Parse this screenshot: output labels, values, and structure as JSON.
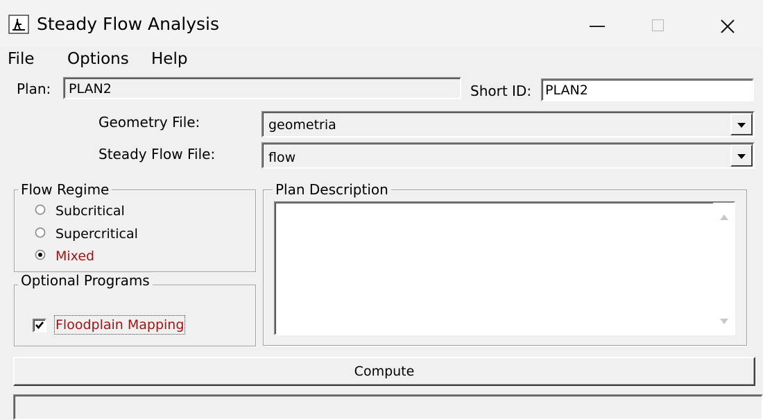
{
  "window": {
    "title": "Steady Flow Analysis",
    "icon": "hec-ras-app-icon"
  },
  "menu": [
    "File",
    "Options",
    "Help"
  ],
  "plan": {
    "label": "Plan:",
    "value": "PLAN2",
    "short_id_label": "Short ID:",
    "short_id_value": "PLAN2"
  },
  "geometry": {
    "label": "Geometry File:",
    "value": "geometria"
  },
  "steady_flow": {
    "label": "Steady Flow File:",
    "value": "flow"
  },
  "flow_regime": {
    "title": "Flow Regime",
    "options": [
      "Subcritical",
      "Supercritical",
      "Mixed"
    ],
    "selected": "Mixed"
  },
  "optional_programs": {
    "title": "Optional Programs",
    "floodplain_mapping_label": "Floodplain Mapping",
    "floodplain_mapping_checked": true
  },
  "plan_description": {
    "title": "Plan Description",
    "value": ""
  },
  "compute_label": "Compute",
  "status_text": "",
  "colors": {
    "accent_red": "#9e1414",
    "background": "#f0f0f0"
  }
}
